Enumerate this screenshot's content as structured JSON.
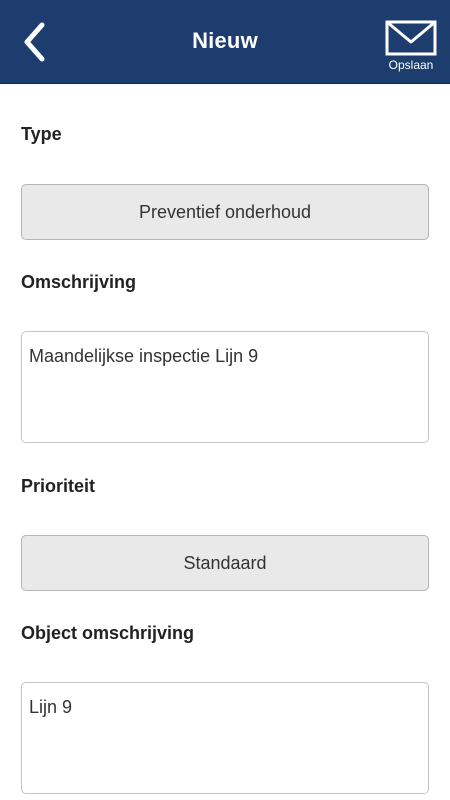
{
  "header": {
    "title": "Nieuw",
    "back_icon": "chevron-left-icon",
    "save_icon": "envelope-icon",
    "save_label": "Opslaan",
    "background_color": "#1c3d6e"
  },
  "form": {
    "type": {
      "label": "Type",
      "value": "Preventief onderhoud"
    },
    "omschrijving": {
      "label": "Omschrijving",
      "value": "Maandelijkse inspectie Lijn 9"
    },
    "prioriteit": {
      "label": "Prioriteit",
      "value": "Standaard"
    },
    "object_omschrijving": {
      "label": "Object omschrijving",
      "value": "Lijn 9"
    }
  }
}
